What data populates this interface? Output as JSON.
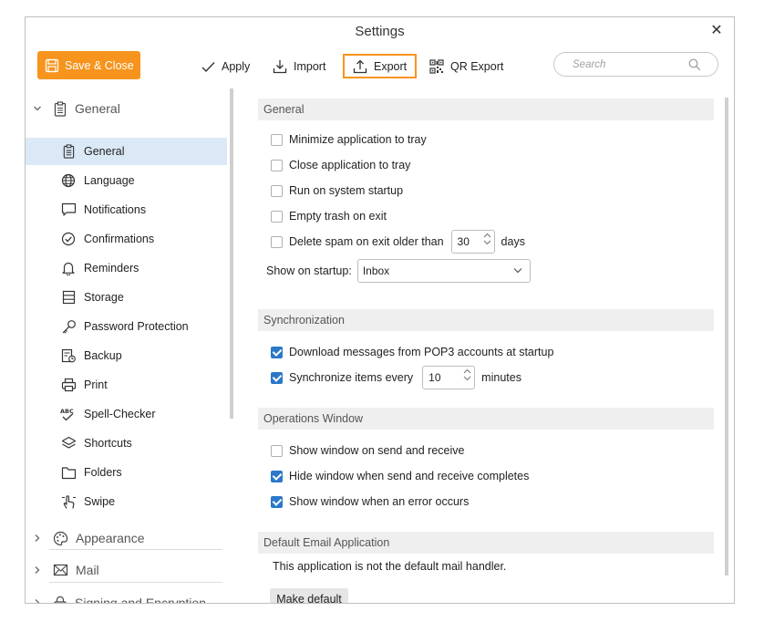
{
  "window": {
    "title": "Settings"
  },
  "toolbar": {
    "save_close": "Save & Close",
    "apply": "Apply",
    "import": "Import",
    "export": "Export",
    "qr_export": "QR Export",
    "search_placeholder": "Search",
    "accent": "#f7941d"
  },
  "sidebar": {
    "general": {
      "label": "General",
      "items": [
        {
          "label": "General",
          "icon": "clipboard-icon"
        },
        {
          "label": "Language",
          "icon": "globe-icon"
        },
        {
          "label": "Notifications",
          "icon": "speech-bubble-icon"
        },
        {
          "label": "Confirmations",
          "icon": "check-circle-icon"
        },
        {
          "label": "Reminders",
          "icon": "bell-icon"
        },
        {
          "label": "Storage",
          "icon": "storage-icon"
        },
        {
          "label": "Password Protection",
          "icon": "key-icon"
        },
        {
          "label": "Backup",
          "icon": "backup-icon"
        },
        {
          "label": "Print",
          "icon": "printer-icon"
        },
        {
          "label": "Spell-Checker",
          "icon": "spellcheck-icon"
        },
        {
          "label": "Shortcuts",
          "icon": "shortcuts-icon"
        },
        {
          "label": "Folders",
          "icon": "folder-icon"
        },
        {
          "label": "Swipe",
          "icon": "swipe-hand-icon"
        }
      ]
    },
    "appearance": "Appearance",
    "mail": "Mail",
    "signing": "Signing and Encryption"
  },
  "general_section": {
    "heading": "General",
    "minimize": "Minimize application to tray",
    "close": "Close application to tray",
    "startup": "Run on system startup",
    "empty_trash": "Empty trash on exit",
    "delete_spam": "Delete spam on exit older than",
    "spam_days": "30",
    "days_label": "days",
    "show_on_startup_label": "Show on startup:",
    "show_on_startup_value": "Inbox"
  },
  "sync_section": {
    "heading": "Synchronization",
    "download_pop3": "Download messages from POP3 accounts at startup",
    "sync_every": "Synchronize items every",
    "sync_minutes": "10",
    "minutes_label": "minutes"
  },
  "ops_section": {
    "heading": "Operations Window",
    "show_send_receive": "Show window on send and receive",
    "hide_complete": "Hide window when send and receive completes",
    "show_error": "Show window when an error occurs"
  },
  "default_section": {
    "heading": "Default Email Application",
    "status": "This application is not the default mail handler.",
    "make_default": "Make default"
  }
}
